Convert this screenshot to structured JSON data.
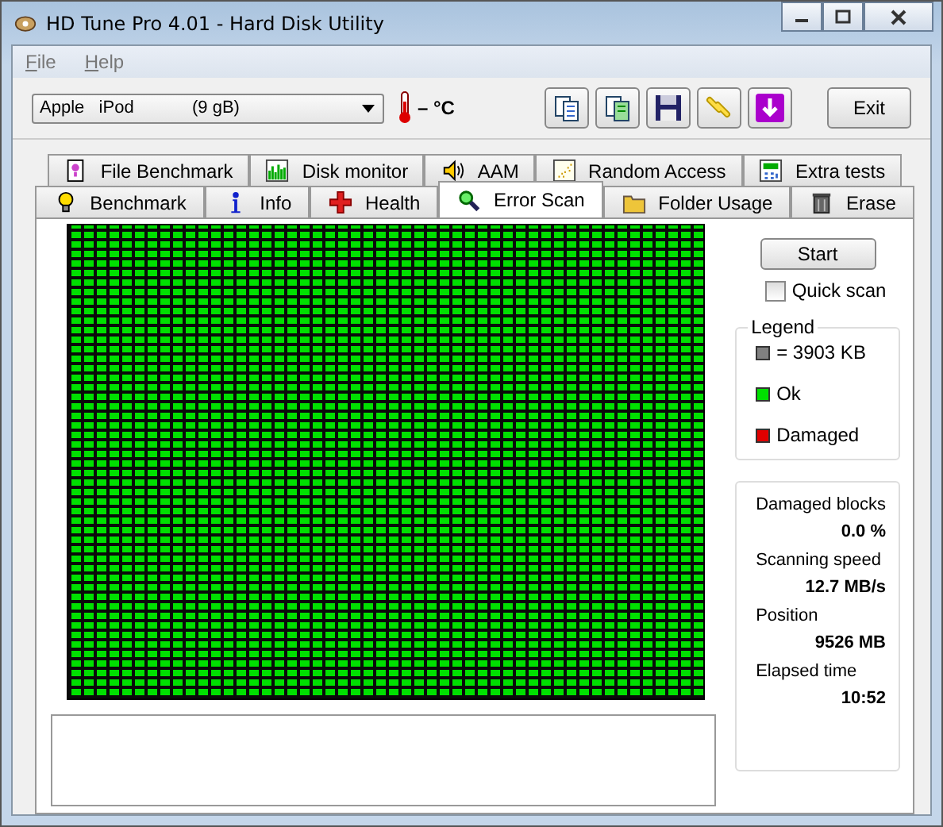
{
  "window": {
    "title": "HD Tune Pro 4.01 - Hard Disk Utility"
  },
  "menu": [
    {
      "label": "File"
    },
    {
      "label": "Help"
    }
  ],
  "drive": {
    "value": "Apple   iPod            (9 gB)"
  },
  "temperature": "– °C",
  "exit_button": "Exit",
  "tab_rows": [
    [
      {
        "label": "File Benchmark",
        "selected": false
      },
      {
        "label": "Disk monitor",
        "selected": false
      },
      {
        "label": "AAM",
        "selected": false
      },
      {
        "label": "Random Access",
        "selected": false
      },
      {
        "label": "Extra tests",
        "selected": false
      }
    ],
    [
      {
        "label": "Benchmark",
        "selected": false
      },
      {
        "label": "Info",
        "selected": false
      },
      {
        "label": "Health",
        "selected": false
      },
      {
        "label": "Error Scan",
        "selected": true
      },
      {
        "label": "Folder Usage",
        "selected": false
      },
      {
        "label": "Erase",
        "selected": false
      }
    ]
  ],
  "start_button": "Start",
  "quick_scan": {
    "label": "Quick scan",
    "checked": false
  },
  "legend": {
    "title": "Legend",
    "items": [
      {
        "label": "= 3903 KB",
        "color": "#808080"
      },
      {
        "label": "Ok",
        "color": "#00e000"
      },
      {
        "label": "Damaged",
        "color": "#e00000"
      }
    ]
  },
  "stats": [
    {
      "label": "Damaged blocks",
      "value": "0.0 %"
    },
    {
      "label": "Scanning speed",
      "value": "12.7 MB/s"
    },
    {
      "label": "Position",
      "value": "9526 MB"
    },
    {
      "label": "Elapsed time",
      "value": "10:52"
    }
  ]
}
